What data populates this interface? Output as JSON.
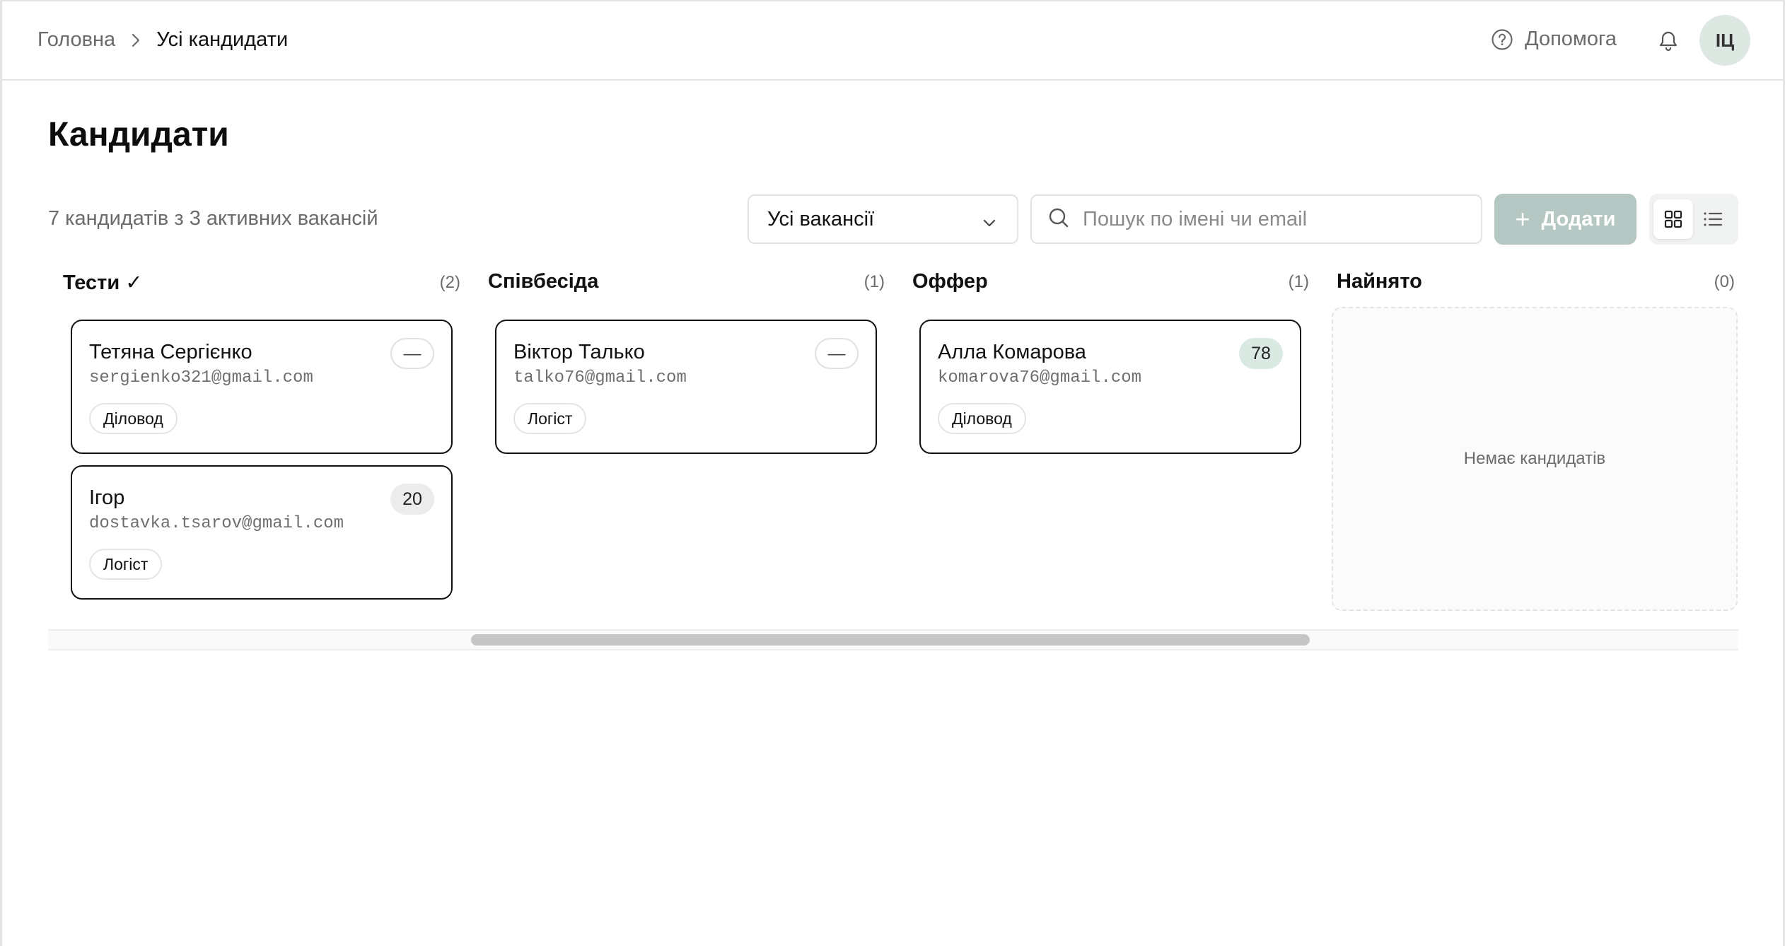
{
  "breadcrumb": {
    "home": "Головна",
    "current": "Усі кандидати"
  },
  "header": {
    "help_label": "Допомога",
    "avatar_initials": "ІЦ"
  },
  "page": {
    "title": "Кандидати",
    "summary": "7 кандидатів з 3 активних вакансій"
  },
  "toolbar": {
    "vacancy_select": "Усі вакансії",
    "search_placeholder": "Пошук по імені чи email",
    "search_value": "",
    "add_label": "Додати",
    "view_mode": "grid"
  },
  "columns": [
    {
      "title": "Тести ✓",
      "count": "(2)",
      "cards": [
        {
          "name": "Тетяна Сергієнко",
          "email": "sergienko321@gmail.com",
          "tag": "Діловод",
          "score": "—",
          "score_style": "empty"
        },
        {
          "name": "Ігор",
          "email": "dostavka.tsarov@gmail.com",
          "tag": "Логіст",
          "score": "20",
          "score_style": "gray"
        }
      ]
    },
    {
      "title": "Співбесіда",
      "count": "(1)",
      "cards": [
        {
          "name": "Віктор Талько",
          "email": "talko76@gmail.com",
          "tag": "Логіст",
          "score": "—",
          "score_style": "empty"
        }
      ]
    },
    {
      "title": "Оффер",
      "count": "(1)",
      "cards": [
        {
          "name": "Алла Комарова",
          "email": "komarova76@gmail.com",
          "tag": "Діловод",
          "score": "78",
          "score_style": "green"
        }
      ]
    },
    {
      "title": "Найнято",
      "count": "(0)",
      "empty_text": "Немає кандидатів",
      "cards": []
    }
  ],
  "colors": {
    "accent_disabled": "#b5c7c2",
    "score_green": "#dbe9e3",
    "avatar_bg": "#dde8e3"
  }
}
